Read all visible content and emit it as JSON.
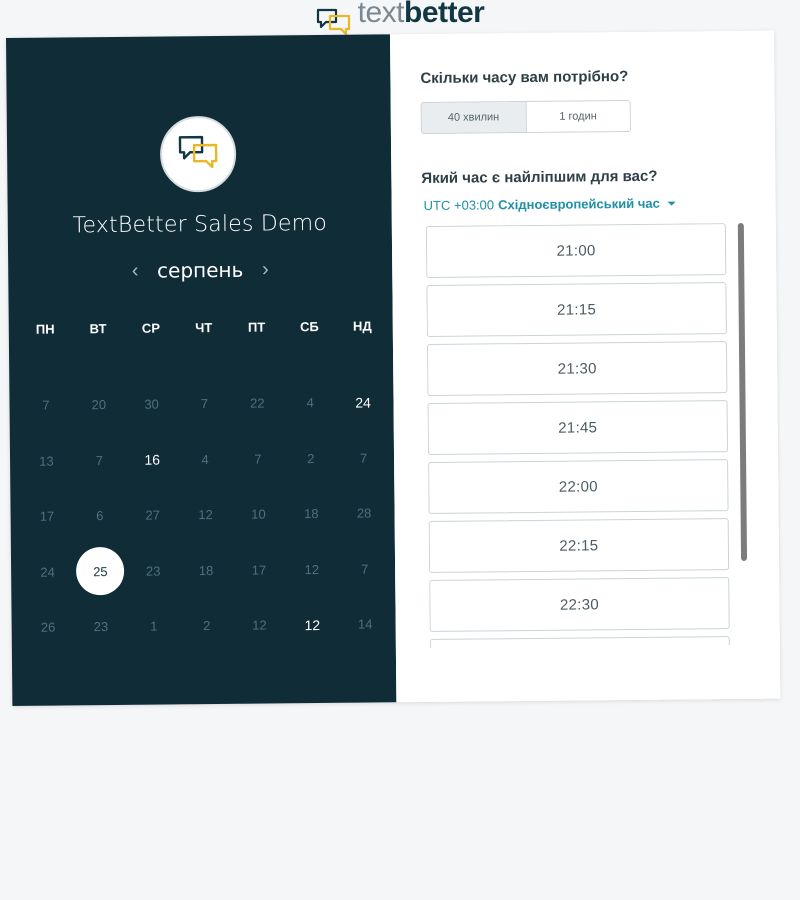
{
  "brand": {
    "name_light": "text",
    "name_bold": "better",
    "logo_icon": "chat-bubbles-icon",
    "accent_color": "#e8b829",
    "dark_color": "#123742"
  },
  "left_panel": {
    "background": "#0f2c37",
    "logo_icon": "chat-bubbles-icon",
    "event_title": "TextBetter Sales Demo",
    "month": "серпень",
    "prev_icon": "chevron-left-icon",
    "next_icon": "chevron-right-icon",
    "weekdays": [
      "ПН",
      "ВТ",
      "СР",
      "ЧТ",
      "ПТ",
      "СБ",
      "НД"
    ],
    "weeks": [
      [
        {
          "d": "7",
          "state": "unavailable"
        },
        {
          "d": "20",
          "state": "unavailable"
        },
        {
          "d": "30",
          "state": "unavailable"
        },
        {
          "d": "7",
          "state": "unavailable"
        },
        {
          "d": "22",
          "state": "unavailable"
        },
        {
          "d": "4",
          "state": "unavailable"
        },
        {
          "d": "24",
          "state": "available"
        }
      ],
      [
        {
          "d": "13",
          "state": "unavailable"
        },
        {
          "d": "7",
          "state": "unavailable"
        },
        {
          "d": "16",
          "state": "available"
        },
        {
          "d": "4",
          "state": "unavailable"
        },
        {
          "d": "7",
          "state": "unavailable"
        },
        {
          "d": "2",
          "state": "unavailable"
        },
        {
          "d": "7",
          "state": "unavailable"
        }
      ],
      [
        {
          "d": "17",
          "state": "unavailable"
        },
        {
          "d": "6",
          "state": "unavailable"
        },
        {
          "d": "27",
          "state": "unavailable"
        },
        {
          "d": "12",
          "state": "unavailable"
        },
        {
          "d": "10",
          "state": "unavailable"
        },
        {
          "d": "18",
          "state": "unavailable"
        },
        {
          "d": "28",
          "state": "unavailable"
        }
      ],
      [
        {
          "d": "24",
          "state": "unavailable"
        },
        {
          "d": "25",
          "state": "selected"
        },
        {
          "d": "23",
          "state": "unavailable"
        },
        {
          "d": "18",
          "state": "unavailable"
        },
        {
          "d": "17",
          "state": "unavailable"
        },
        {
          "d": "12",
          "state": "unavailable"
        },
        {
          "d": "7",
          "state": "unavailable"
        }
      ],
      [
        {
          "d": "26",
          "state": "unavailable"
        },
        {
          "d": "23",
          "state": "unavailable"
        },
        {
          "d": "1",
          "state": "unavailable"
        },
        {
          "d": "2",
          "state": "unavailable"
        },
        {
          "d": "12",
          "state": "unavailable"
        },
        {
          "d": "12",
          "state": "available"
        },
        {
          "d": "14",
          "state": "unavailable"
        }
      ]
    ]
  },
  "right_panel": {
    "duration_question": "Скільки часу вам потрібно?",
    "durations": [
      {
        "label": "40 хвилин",
        "active": true
      },
      {
        "label": "1 годин",
        "active": false
      }
    ],
    "time_question": "Який час є найліпшим для вас?",
    "timezone": {
      "offset": "UTC +03:00",
      "name": "Східноєвропейський час",
      "color": "#1e8fa6"
    },
    "slots": [
      "21:00",
      "21:15",
      "21:30",
      "21:45",
      "22:00",
      "22:15",
      "22:30",
      ""
    ]
  }
}
